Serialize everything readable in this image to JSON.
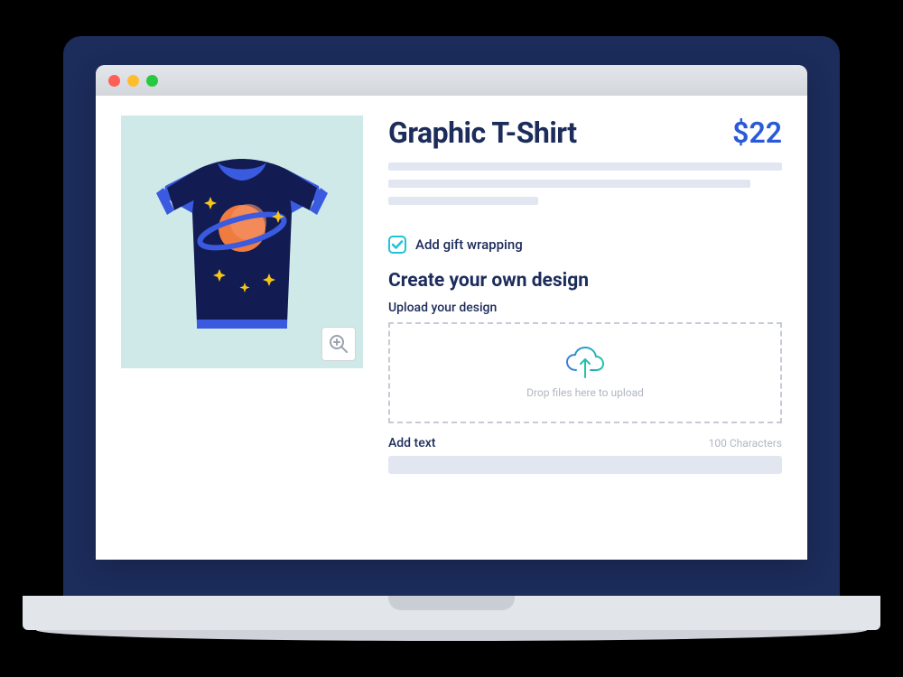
{
  "product": {
    "title": "Graphic T-Shirt",
    "price": "$22"
  },
  "options": {
    "gift_wrap_label": "Add gift wrapping",
    "gift_wrap_checked": true
  },
  "custom": {
    "heading": "Create your own design",
    "upload_label": "Upload your design",
    "drop_hint": "Drop files here to upload",
    "addtext_label": "Add text",
    "char_limit": "100 Characters"
  },
  "colors": {
    "accent_navy": "#1c2c5b",
    "accent_blue": "#2a5ad7",
    "accent_teal": "#1fc3d8"
  }
}
